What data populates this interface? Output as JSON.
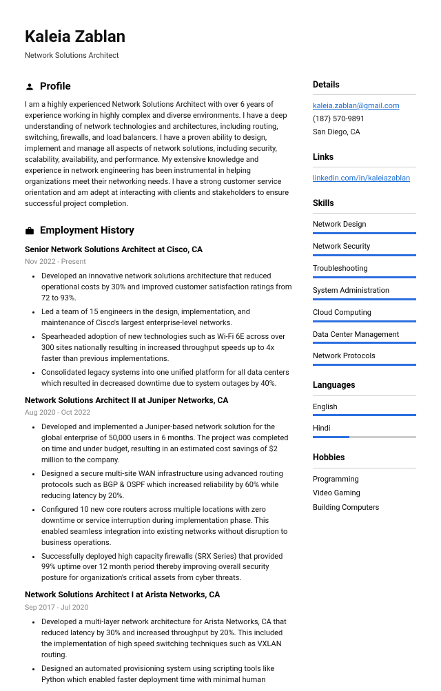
{
  "name": "Kaleia Zablan",
  "title": "Network Solutions Architect",
  "sections": {
    "profile": "Profile",
    "employment": "Employment History"
  },
  "profile": "I am a highly experienced Network Solutions Architect with over 6 years of experience working in highly complex and diverse environments. I have a deep understanding of network technologies and architectures, including routing, switching, firewalls, and load balancers. I have a proven ability to design, implement and manage all aspects of network solutions, including security, scalability, availability, and performance. My extensive knowledge and experience in network engineering has been instrumental in helping organizations meet their networking needs. I have a strong customer service orientation and am adept at interacting with clients and stakeholders to ensure successful project completion.",
  "jobs": [
    {
      "title": "Senior Network Solutions Architect at Cisco, CA",
      "dates": "Nov 2022 - Present",
      "bullets": [
        "Developed an innovative network solutions architecture that reduced operational costs by 30% and improved customer satisfaction ratings from 72 to 93%.",
        "Led a team of 15 engineers in the design, implementation, and maintenance of Cisco's largest enterprise-level networks.",
        "Spearheaded adoption of new technologies such as Wi-Fi 6E across over 300 sites nationally resulting in increased throughput speeds up to 4x faster than previous implementations.",
        "Consolidated legacy systems into one unified platform for all data centers which resulted in decreased downtime due to system outages by 40%."
      ]
    },
    {
      "title": "Network Solutions Architect II at Juniper Networks, CA",
      "dates": "Aug 2020 - Oct 2022",
      "bullets": [
        "Developed and implemented a Juniper-based network solution for the global enterprise of 50,000 users in 6 months. The project was completed on time and under budget, resulting in an estimated cost savings of $2 million to the company.",
        "Designed a secure multi-site WAN infrastructure using advanced routing protocols such as BGP & OSPF which increased reliability by 60% while reducing latency by 20%.",
        "Configured 10 new core routers across multiple locations with zero downtime or service interruption during implementation phase. This enabled seamless integration into existing networks without disruption to business operations.",
        "Successfully deployed high capacity firewalls (SRX Series) that provided 99% uptime over 12 month period thereby improving overall security posture for organization's critical assets from cyber threats."
      ]
    },
    {
      "title": "Network Solutions Architect I at Arista Networks, CA",
      "dates": "Sep 2017 - Jul 2020",
      "bullets": [
        "Developed a multi-layer network architecture for Arista Networks, CA that reduced latency by 30% and increased throughput by 20%. This included the implementation of high speed switching techniques such as VXLAN routing.",
        "Designed an automated provisioning system using scripting tools like Python which enabled faster deployment time with minimal human"
      ]
    }
  ],
  "side": {
    "details": {
      "title": "Details",
      "email": "kaleia.zablan@gmail.com",
      "phone": "(187) 570-9891",
      "location": "San Diego, CA"
    },
    "links": {
      "title": "Links",
      "items": [
        "linkedin.com/in/kaleiazablan"
      ]
    },
    "skills": {
      "title": "Skills",
      "items": [
        {
          "name": "Network Design",
          "level": 100
        },
        {
          "name": "Network Security",
          "level": 100
        },
        {
          "name": "Troubleshooting",
          "level": 100
        },
        {
          "name": "System Administration",
          "level": 100
        },
        {
          "name": "Cloud Computing",
          "level": 100
        },
        {
          "name": "Data Center Management",
          "level": 100
        },
        {
          "name": "Network Protocols",
          "level": 100
        }
      ]
    },
    "languages": {
      "title": "Languages",
      "items": [
        {
          "name": "English",
          "level": 100
        },
        {
          "name": "Hindi",
          "level": 35
        }
      ]
    },
    "hobbies": {
      "title": "Hobbies",
      "items": [
        "Programming",
        "Video Gaming",
        "Building Computers"
      ]
    }
  }
}
